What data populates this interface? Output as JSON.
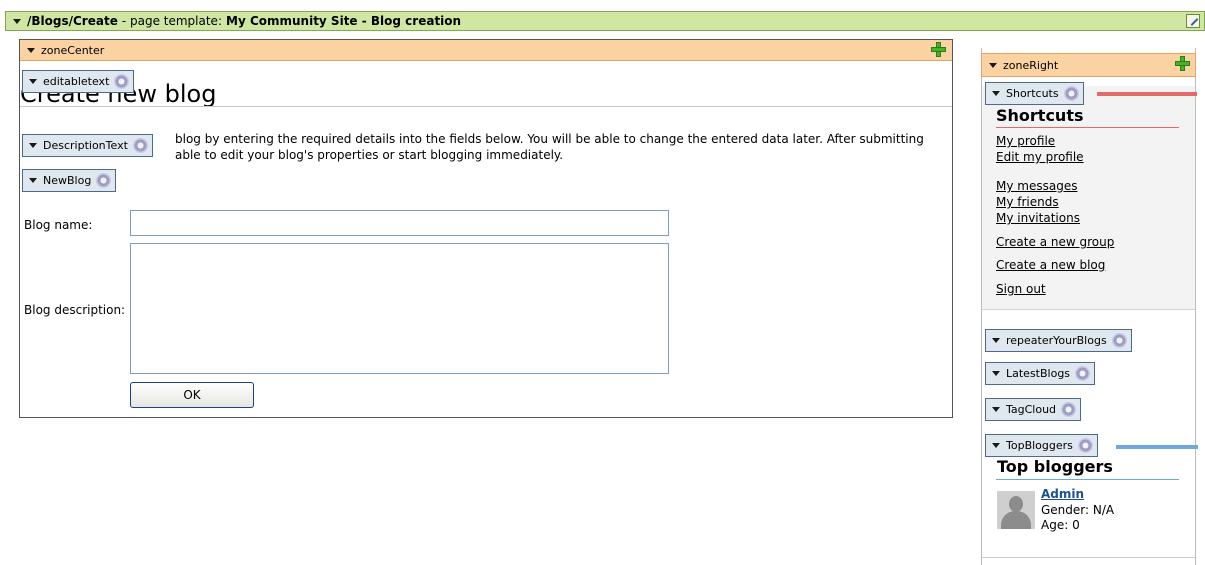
{
  "template_bar": {
    "path": "/Blogs/Create",
    "label": "- page template:",
    "template_name": "My Community Site - Blog creation"
  },
  "zone_center": {
    "name": "zoneCenter",
    "webparts": {
      "editabletext": "editabletext",
      "description_text": "DescriptionText",
      "new_blog": "NewBlog"
    },
    "heading_hidden": "Create new",
    "heading_visible": "blog",
    "description_line1": "blog by entering the required details into the fields below. You will be able to change the entered data later. After submitting",
    "description_line2": "able to edit your blog's properties or start blogging immediately.",
    "form": {
      "blog_name_label": "Blog name:",
      "blog_name_value": "",
      "blog_description_label": "Blog description:",
      "blog_description_value": "",
      "ok_label": "OK"
    }
  },
  "zone_right": {
    "name": "zoneRight",
    "shortcuts_webpart": "Shortcuts",
    "shortcuts_title": "Shortcuts",
    "links": {
      "my_profile": "My profile",
      "edit_my_profile": "Edit my profile",
      "my_messages": "My messages",
      "my_friends": "My friends",
      "my_invitations": "My invitations",
      "create_group": "Create a new group",
      "create_blog": "Create a new blog",
      "sign_out": "Sign out"
    },
    "webparts": {
      "repeater": "repeaterYourBlogs",
      "latest": "LatestBlogs",
      "tagcloud": "TagCloud",
      "topbloggers": "TopBloggers"
    },
    "top_bloggers_title": "Top bloggers",
    "blogger": {
      "name": "Admin",
      "gender": "Gender: N/A",
      "age": "Age: 0"
    }
  },
  "colors": {
    "template_bar": "#cfe7a3",
    "zone_header": "#fbd3a3",
    "webpart_handle": "#dfe8ee",
    "shortcuts_accent": "#e36a6a",
    "topbloggers_accent": "#6fa8dc",
    "link_admin": "#1d4f91"
  },
  "icons": [
    "triangle-down-icon",
    "edit-page-icon",
    "add-webpart-icon",
    "gear-icon",
    "user-avatar-icon"
  ]
}
